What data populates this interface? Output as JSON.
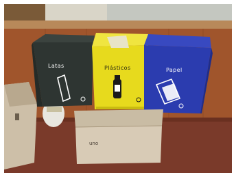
{
  "bins": [
    {
      "label": "Latas",
      "color": "#2e3532"
    },
    {
      "label": "Plásticos",
      "color": "#e7da1d"
    },
    {
      "label": "Papel",
      "color": "#2b3caf"
    }
  ],
  "box": {
    "brand_label": "uno"
  },
  "icons": [
    "can-icon",
    "bottle-icon",
    "paper-icon",
    "recycle-icon"
  ],
  "colors": {
    "wall_wood": "#a0552c",
    "floor": "#7a3a2a",
    "cardboard_box": "#d8cbb6"
  }
}
